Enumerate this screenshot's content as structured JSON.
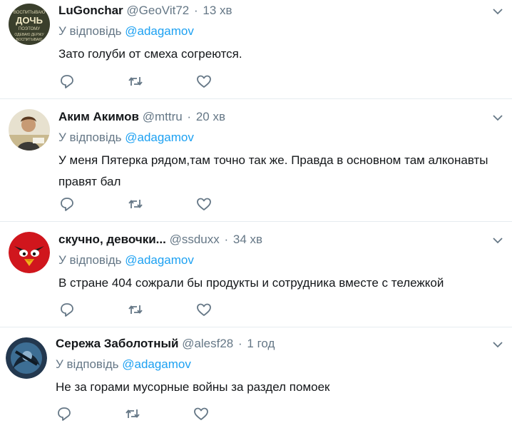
{
  "reply_prefix": "У відповідь",
  "tweets": [
    {
      "name": "LuGonchar",
      "handle": "@GeoVit72",
      "time": "13 хв",
      "mention": "@adagamov",
      "text": "Зато голуби от смеха согреются.",
      "avatar_label": "ВОСПИТЫВАЮ ДОЧЬ ПОЭТОМУ ОДЕВАЮ ДЕРЖУ ВОСПИТЫВАЮ",
      "avatar_color": "#3a3f2c"
    },
    {
      "name": "Аким Акимов",
      "handle": "@mttru",
      "time": "20 хв",
      "mention": "@adagamov",
      "text": "У меня Пятерка рядом,там точно так же. Правда в основном там алконавты правят бал",
      "avatar_color": "#d9cfb6"
    },
    {
      "name": "скучно, девочки...",
      "handle": "@ssduxx",
      "time": "34 хв",
      "mention": "@adagamov",
      "text": "В стране 404 сожрали бы продукты и сотрудника вместе с тележкой",
      "avatar_color": "#d0161d"
    },
    {
      "name": "Сережа Заболотный",
      "handle": "@alesf28",
      "time": "1 год",
      "mention": "@adagamov",
      "text": "Не за горами мусорные войны за раздел помоек",
      "avatar_color": "#2a4d6b"
    }
  ],
  "colors": {
    "link": "#1da1f2",
    "muted": "#657786",
    "divider": "#e6ecf0"
  },
  "icons": [
    "reply-icon",
    "retweet-icon",
    "like-icon",
    "chevron-down-icon"
  ]
}
